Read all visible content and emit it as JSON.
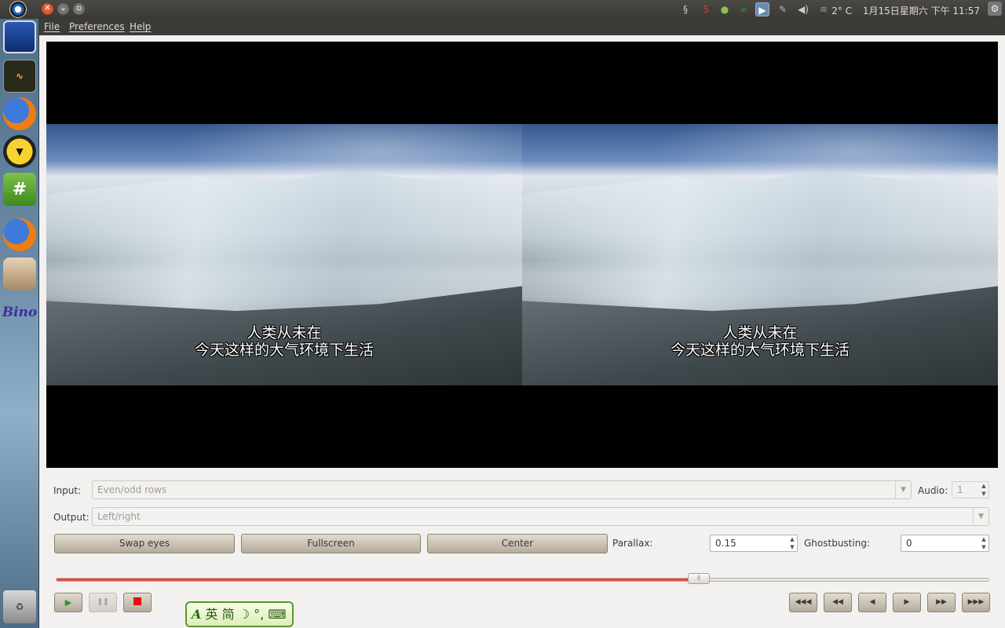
{
  "top_panel": {
    "window_buttons": {
      "close_icon": "close-icon",
      "minimize_icon": "minimize-icon",
      "maximize_icon": "maximize-icon"
    },
    "tray_icons": [
      "swirl-icon",
      "s-icon",
      "apple-icon",
      "network-icon",
      "player-icon",
      "tools-icon",
      "volume-icon"
    ],
    "weather": "2° C",
    "datetime": "1月15日星期六 下午 11:57"
  },
  "launcher": {
    "items": [
      {
        "icon": "display-icon"
      },
      {
        "icon": "system-monitor-icon"
      },
      {
        "icon": "firefox-icon"
      },
      {
        "icon": "batman-icon"
      },
      {
        "icon": "chat-icon",
        "glyph": "#"
      },
      {
        "icon": "firefox-icon"
      },
      {
        "icon": "shell-icon"
      },
      {
        "icon": "bino-icon",
        "glyph": "Bino"
      },
      {
        "icon": "trash-icon"
      }
    ]
  },
  "menu": {
    "file": "File",
    "preferences": "Preferences",
    "help": "Help"
  },
  "video": {
    "subtitle_line1": "人类从未在",
    "subtitle_line2": "今天这样的大气环境下生活"
  },
  "controls": {
    "input_label": "Input:",
    "input_value": "Even/odd rows",
    "audio_label": "Audio:",
    "audio_value": "1",
    "output_label": "Output:",
    "output_value": "Left/right",
    "swap_eyes": "Swap eyes",
    "fullscreen": "Fullscreen",
    "center": "Center",
    "parallax_label": "Parallax:",
    "parallax_value": "0.15",
    "ghostbusting_label": "Ghostbusting:",
    "ghostbusting_value": "0"
  },
  "playback": {
    "progress": 0.69,
    "buttons": [
      "play-icon",
      "pause-icon",
      "stop-icon",
      "rewind-fast-icon",
      "rewind-icon",
      "step-back-icon",
      "step-forward-icon",
      "forward-icon",
      "forward-fast-icon"
    ]
  },
  "ime": {
    "mode_a": "A",
    "lang": "英",
    "charset": "简",
    "moon": "☽",
    "punct": "°,",
    "keyboard": "⌨"
  }
}
